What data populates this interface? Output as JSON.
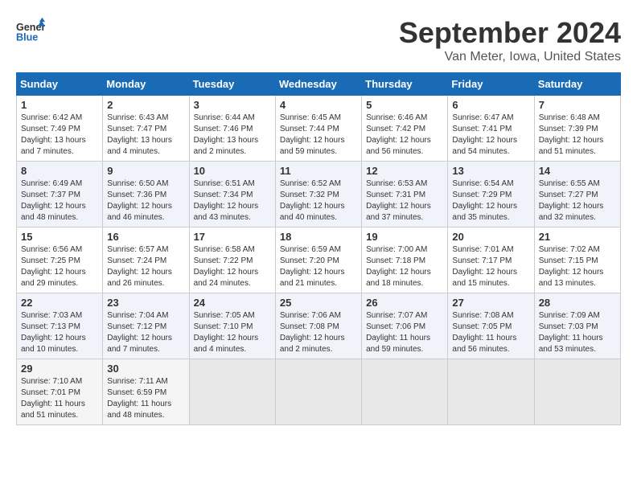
{
  "header": {
    "logo_line1": "General",
    "logo_line2": "Blue",
    "month_year": "September 2024",
    "location": "Van Meter, Iowa, United States"
  },
  "weekdays": [
    "Sunday",
    "Monday",
    "Tuesday",
    "Wednesday",
    "Thursday",
    "Friday",
    "Saturday"
  ],
  "weeks": [
    [
      {
        "day": "1",
        "sunrise": "6:42 AM",
        "sunset": "7:49 PM",
        "daylight": "13 hours and 7 minutes."
      },
      {
        "day": "2",
        "sunrise": "6:43 AM",
        "sunset": "7:47 PM",
        "daylight": "13 hours and 4 minutes."
      },
      {
        "day": "3",
        "sunrise": "6:44 AM",
        "sunset": "7:46 PM",
        "daylight": "13 hours and 2 minutes."
      },
      {
        "day": "4",
        "sunrise": "6:45 AM",
        "sunset": "7:44 PM",
        "daylight": "12 hours and 59 minutes."
      },
      {
        "day": "5",
        "sunrise": "6:46 AM",
        "sunset": "7:42 PM",
        "daylight": "12 hours and 56 minutes."
      },
      {
        "day": "6",
        "sunrise": "6:47 AM",
        "sunset": "7:41 PM",
        "daylight": "12 hours and 54 minutes."
      },
      {
        "day": "7",
        "sunrise": "6:48 AM",
        "sunset": "7:39 PM",
        "daylight": "12 hours and 51 minutes."
      }
    ],
    [
      {
        "day": "8",
        "sunrise": "6:49 AM",
        "sunset": "7:37 PM",
        "daylight": "12 hours and 48 minutes."
      },
      {
        "day": "9",
        "sunrise": "6:50 AM",
        "sunset": "7:36 PM",
        "daylight": "12 hours and 46 minutes."
      },
      {
        "day": "10",
        "sunrise": "6:51 AM",
        "sunset": "7:34 PM",
        "daylight": "12 hours and 43 minutes."
      },
      {
        "day": "11",
        "sunrise": "6:52 AM",
        "sunset": "7:32 PM",
        "daylight": "12 hours and 40 minutes."
      },
      {
        "day": "12",
        "sunrise": "6:53 AM",
        "sunset": "7:31 PM",
        "daylight": "12 hours and 37 minutes."
      },
      {
        "day": "13",
        "sunrise": "6:54 AM",
        "sunset": "7:29 PM",
        "daylight": "12 hours and 35 minutes."
      },
      {
        "day": "14",
        "sunrise": "6:55 AM",
        "sunset": "7:27 PM",
        "daylight": "12 hours and 32 minutes."
      }
    ],
    [
      {
        "day": "15",
        "sunrise": "6:56 AM",
        "sunset": "7:25 PM",
        "daylight": "12 hours and 29 minutes."
      },
      {
        "day": "16",
        "sunrise": "6:57 AM",
        "sunset": "7:24 PM",
        "daylight": "12 hours and 26 minutes."
      },
      {
        "day": "17",
        "sunrise": "6:58 AM",
        "sunset": "7:22 PM",
        "daylight": "12 hours and 24 minutes."
      },
      {
        "day": "18",
        "sunrise": "6:59 AM",
        "sunset": "7:20 PM",
        "daylight": "12 hours and 21 minutes."
      },
      {
        "day": "19",
        "sunrise": "7:00 AM",
        "sunset": "7:18 PM",
        "daylight": "12 hours and 18 minutes."
      },
      {
        "day": "20",
        "sunrise": "7:01 AM",
        "sunset": "7:17 PM",
        "daylight": "12 hours and 15 minutes."
      },
      {
        "day": "21",
        "sunrise": "7:02 AM",
        "sunset": "7:15 PM",
        "daylight": "12 hours and 13 minutes."
      }
    ],
    [
      {
        "day": "22",
        "sunrise": "7:03 AM",
        "sunset": "7:13 PM",
        "daylight": "12 hours and 10 minutes."
      },
      {
        "day": "23",
        "sunrise": "7:04 AM",
        "sunset": "7:12 PM",
        "daylight": "12 hours and 7 minutes."
      },
      {
        "day": "24",
        "sunrise": "7:05 AM",
        "sunset": "7:10 PM",
        "daylight": "12 hours and 4 minutes."
      },
      {
        "day": "25",
        "sunrise": "7:06 AM",
        "sunset": "7:08 PM",
        "daylight": "12 hours and 2 minutes."
      },
      {
        "day": "26",
        "sunrise": "7:07 AM",
        "sunset": "7:06 PM",
        "daylight": "11 hours and 59 minutes."
      },
      {
        "day": "27",
        "sunrise": "7:08 AM",
        "sunset": "7:05 PM",
        "daylight": "11 hours and 56 minutes."
      },
      {
        "day": "28",
        "sunrise": "7:09 AM",
        "sunset": "7:03 PM",
        "daylight": "11 hours and 53 minutes."
      }
    ],
    [
      {
        "day": "29",
        "sunrise": "7:10 AM",
        "sunset": "7:01 PM",
        "daylight": "11 hours and 51 minutes."
      },
      {
        "day": "30",
        "sunrise": "7:11 AM",
        "sunset": "6:59 PM",
        "daylight": "11 hours and 48 minutes."
      },
      null,
      null,
      null,
      null,
      null
    ]
  ]
}
